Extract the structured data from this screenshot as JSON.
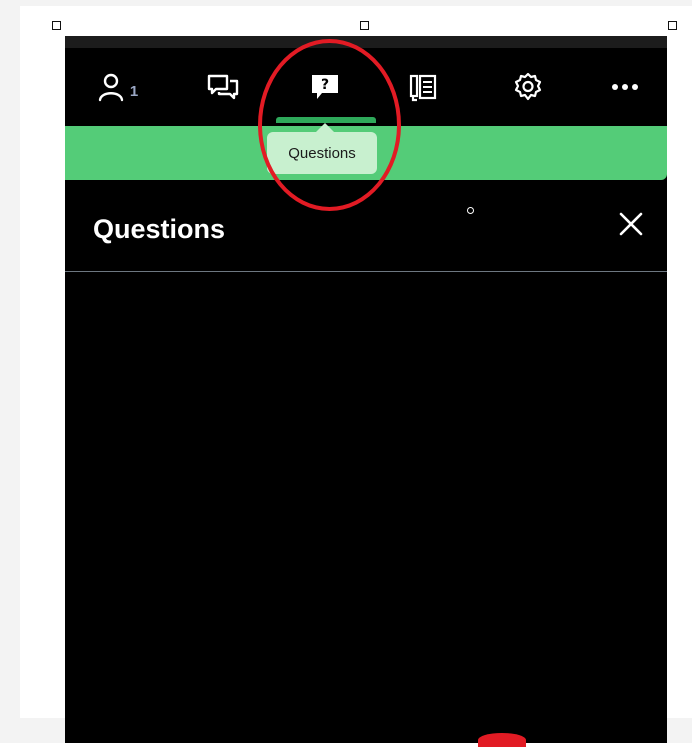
{
  "toolbar": {
    "participants": {
      "icon": "person-icon",
      "count": "1"
    },
    "chat": {
      "icon": "chat-icon"
    },
    "questions": {
      "icon": "question-bubble-icon"
    },
    "notes": {
      "icon": "notes-icon"
    },
    "settings": {
      "icon": "gear-icon"
    },
    "more": {
      "icon": "more-icon"
    }
  },
  "tooltip": {
    "text": "Questions"
  },
  "panel": {
    "title": "Questions"
  },
  "colors": {
    "accent_green": "#54cc78",
    "annotation_red": "#e21b24",
    "panel_background": "#000000"
  }
}
